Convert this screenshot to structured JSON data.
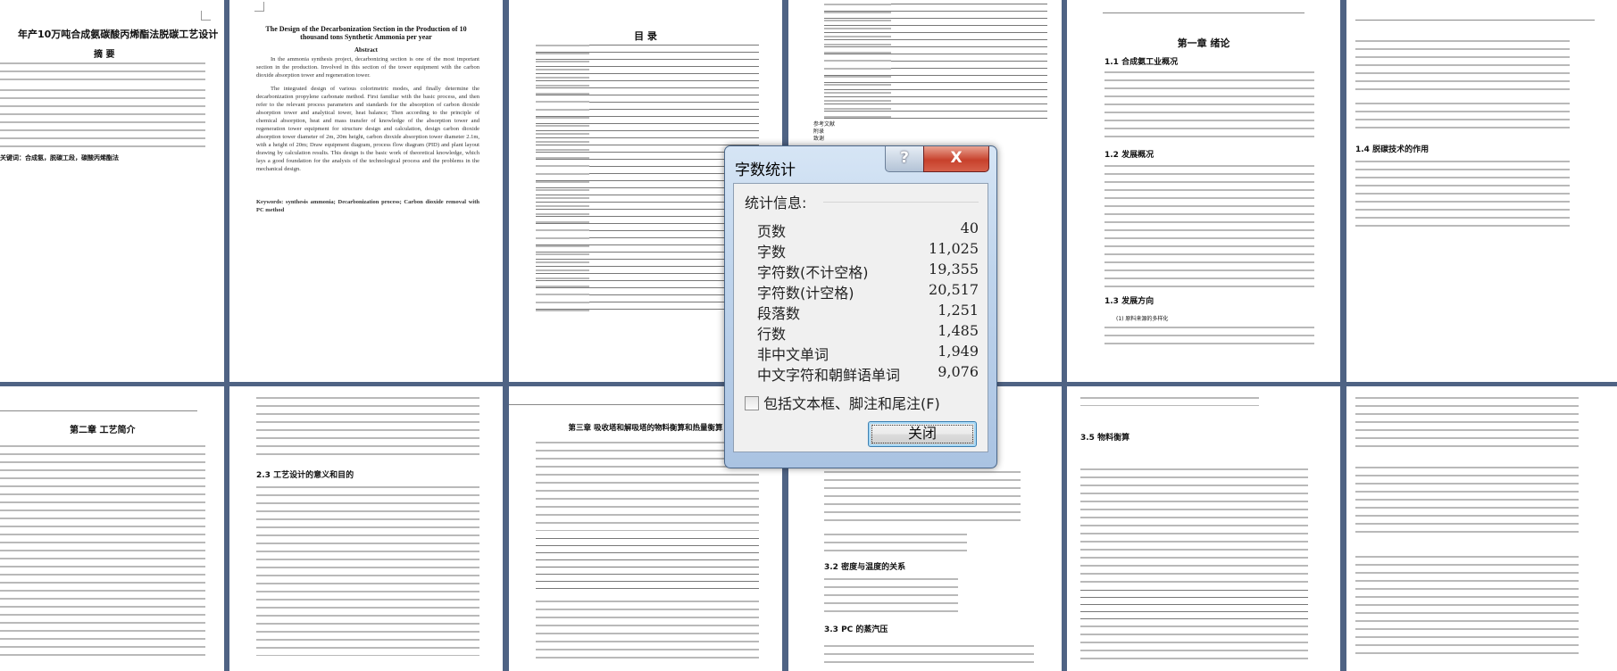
{
  "document": {
    "row1": {
      "p1": {
        "title": "年产10万吨合成氨碳酸丙烯酯法脱碳工艺设计",
        "abstract_heading": "摘 要",
        "keywords": "关键词：合成氨，脱碳工段，碳酸丙烯酯法"
      },
      "p2": {
        "title": "The Design of the Decarbonization Section in the Production of 10 thousand tons Synthetic Ammonia per year",
        "abstract_heading": "Abstract",
        "para1": "In the ammonia synthesis project, decarbonizing section is one of the most important section in the production. Involved in this section of the tower equipment with the carbon dioxide absorption tower and regeneration tower.",
        "para2": "The integrated design of various colorimetric modes, and finally determine the decarbonization propylene carbonate method. First familiar with the basic process, and then refer to the relevant process parameters and standards for the absorption of carbon dioxide absorption tower and analytical tower, heat balance; Then according to the principle of chemical absorption, heat and mass transfer of knowledge of the absorption tower and regeneration tower equipment for structure design and calculation, design carbon dioxide absorption tower diameter of 2m, 20m height, carbon dioxide absorption tower diameter 2.1m, with a height of 20m; Draw equipment diagram, process flow diagram (PID) and plant layout drawing by calculation results. This design is the basic work of theoretical knowledge, which lays a good foundation for the analysis of the technological process and the problems in the mechanical design.",
        "keywords": "Keywords: synthesis ammonia; Decarbonization process; Carbon dioxide removal with PC method"
      },
      "p3": {
        "title": "目 录"
      },
      "p4": {
        "toc_tail": [
          "参考文献",
          "附录",
          "致谢"
        ]
      },
      "p5": {
        "chapter": "第一章 绪论",
        "s1": "1.1 合成氨工业概况",
        "s2": "1.2 发展概况",
        "s3": "1.3 发展方向",
        "item1": "(1) 原料来源的多样化"
      },
      "p6": {
        "s4": "1.4 脱碳技术的作用"
      }
    },
    "row2": {
      "p1": {
        "chapter": "第二章 工艺简介"
      },
      "p2": {
        "s1": "2.3 工艺设计的意义和目的"
      },
      "p3": {
        "chapter": "第三章 吸收塔和解吸塔的物料衡算和热量衡算"
      },
      "p4": {
        "s1": "3.2 密度与温度的关系",
        "s2": "3.3 PC 的蒸汽压"
      },
      "p5": {
        "s1": "3.5 物料衡算"
      }
    }
  },
  "dialog": {
    "title": "字数统计",
    "help_label": "?",
    "close_x": "X",
    "section_label": "统计信息:",
    "stats": [
      {
        "label": "页数",
        "value": "40"
      },
      {
        "label": "字数",
        "value": "11,025"
      },
      {
        "label": "字符数(不计空格)",
        "value": "19,355"
      },
      {
        "label": "字符数(计空格)",
        "value": "20,517"
      },
      {
        "label": "段落数",
        "value": "1,251"
      },
      {
        "label": "行数",
        "value": "1,485"
      },
      {
        "label": "非中文单词",
        "value": "1,949"
      },
      {
        "label": "中文字符和朝鲜语单词",
        "value": "9,076"
      }
    ],
    "checkbox_label": "包括文本框、脚注和尾注(F)",
    "checkbox_checked": false,
    "close_button": "关闭"
  }
}
